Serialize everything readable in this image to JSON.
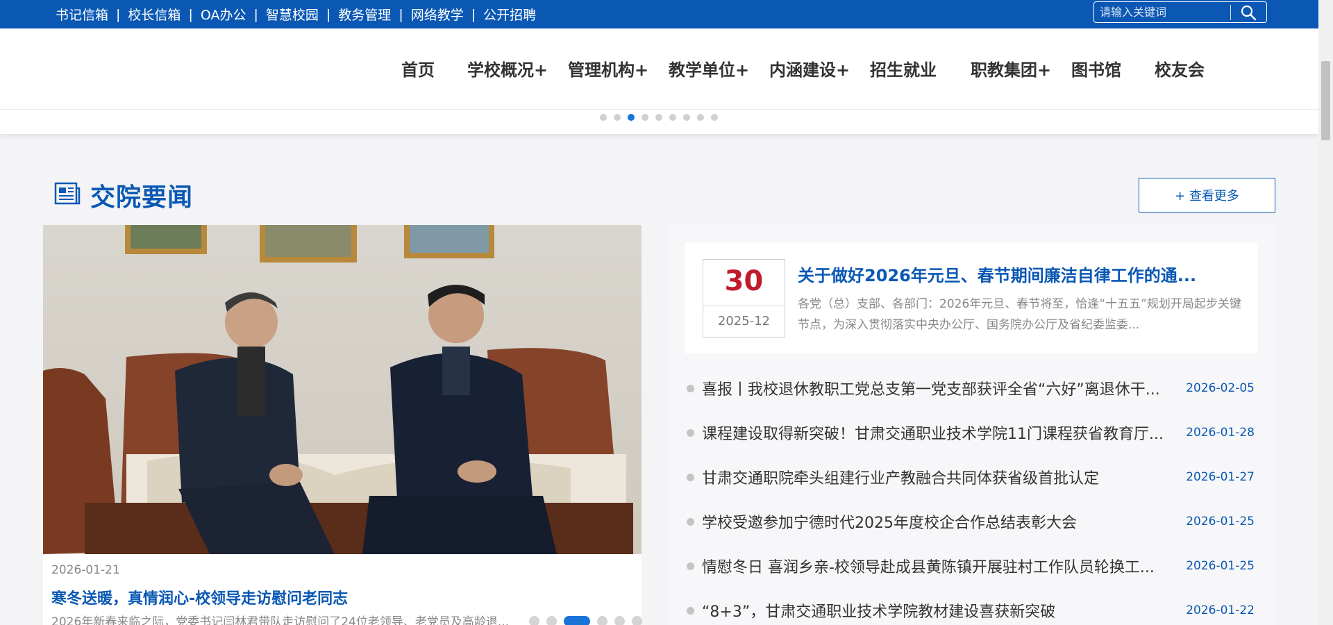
{
  "topbar": {
    "links": [
      "书记信箱",
      "校长信箱",
      "OA办公",
      "智慧校园",
      "教务管理",
      "网络教学",
      "公开招聘"
    ],
    "separator": "|",
    "search_placeholder": "请输入关键词",
    "search_icon": "search-icon"
  },
  "nav": {
    "items": [
      "首页",
      "学校概况+",
      "管理机构+",
      "教学单位+",
      "内涵建设+",
      "招生就业",
      "职教集团+",
      "图书馆",
      "校友会"
    ],
    "banner_dots_total": 9,
    "banner_dots_active_index": 2
  },
  "section": {
    "title": "交院要闻",
    "icon": "newspaper-icon",
    "more_label": "+ 查看更多"
  },
  "feature": {
    "date": "2026-01-21",
    "title": "寒冬送暖，真情润心-校领导走访慰问老同志",
    "summary": "2026年新春来临之际，党委书记闫林君带队走访慰问了24位老领导、老党员及高龄退...",
    "slider_dots_total": 6,
    "slider_dots_active_index": 2
  },
  "top_news": {
    "day": "30",
    "year_month": "2025-12",
    "title": "关于做好2026年元旦、春节期间廉洁自律工作的通...",
    "summary": "各党（总）支部、各部门：2026年元旦、春节将至，恰逢“十五五”规划开局起步关键节点，为深入贯彻落实中央办公厅、国务院办公厅及省纪委监委..."
  },
  "news_list": [
    {
      "title": "喜报丨我校退休教职工党总支第一党支部获评全省“六好”离退休干...",
      "date": "2026-02-05"
    },
    {
      "title": "课程建设取得新突破！甘肃交通职业技术学院11门课程获省教育厅...",
      "date": "2026-01-28"
    },
    {
      "title": "甘肃交通职院牵头组建行业产教融合共同体获省级首批认定",
      "date": "2026-01-27"
    },
    {
      "title": "学校受邀参加宁德时代2025年度校企合作总结表彰大会",
      "date": "2026-01-25"
    },
    {
      "title": "情慰冬日 喜润乡亲-校领导赴成县黄陈镇开展驻村工作队员轮换工...",
      "date": "2026-01-25"
    },
    {
      "title": "“8+3”，甘肃交通职业技术学院教材建设喜获新突破",
      "date": "2026-01-22"
    }
  ],
  "colors": {
    "brand_blue": "#0a58b4",
    "date_red": "#c01a2b",
    "active_dot": "#1a73d9"
  }
}
